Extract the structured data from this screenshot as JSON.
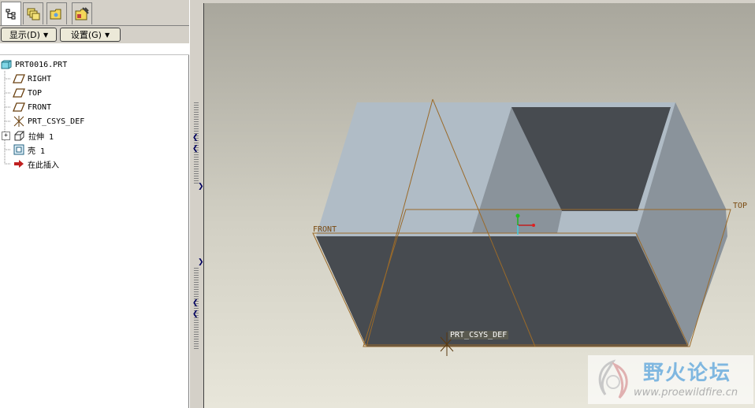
{
  "sidebar": {
    "tabs": [
      {
        "icon": "model-tree-icon"
      },
      {
        "icon": "layers-icon"
      },
      {
        "icon": "folder-browser-icon"
      },
      {
        "icon": "favorites-icon"
      }
    ],
    "buttons": {
      "display_label": "显示(D)",
      "settings_label": "设置(G)"
    },
    "tree": [
      {
        "label": "PRT0016.PRT",
        "icon": "part-icon"
      },
      {
        "label": "RIGHT",
        "icon": "datum-plane-icon"
      },
      {
        "label": "TOP",
        "icon": "datum-plane-icon"
      },
      {
        "label": "FRONT",
        "icon": "datum-plane-icon"
      },
      {
        "label": "PRT_CSYS_DEF",
        "icon": "csys-icon"
      },
      {
        "label": "拉伸 1",
        "icon": "extrude-icon"
      },
      {
        "label": "壳 1",
        "icon": "shell-icon"
      },
      {
        "label": "在此插入",
        "icon": "insert-here-arrow-icon"
      }
    ]
  },
  "viewport": {
    "labels": {
      "front": "FRONT",
      "top": "TOP",
      "csys": "PRT_CSYS_DEF"
    },
    "colors": {
      "face_light": "#b0bcc6",
      "face_mid": "#8a939b",
      "face_dark": "#474b50",
      "datum": "#9a6a2a"
    }
  },
  "watermark": {
    "title": "野火论坛",
    "url": "www.proewildfire.cn"
  }
}
